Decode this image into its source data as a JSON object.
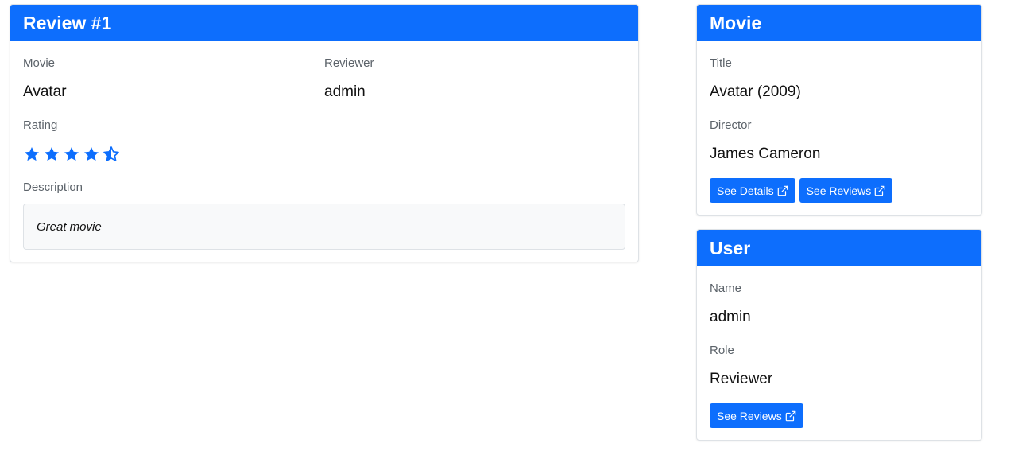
{
  "review": {
    "title": "Review #1",
    "movie_label": "Movie",
    "movie_value": "Avatar",
    "reviewer_label": "Reviewer",
    "reviewer_value": "admin",
    "rating_label": "Rating",
    "rating_value": 4.5,
    "rating_max": 5,
    "description_label": "Description",
    "description_value": "Great movie"
  },
  "movie": {
    "header": "Movie",
    "title_label": "Title",
    "title_value": "Avatar (2009)",
    "director_label": "Director",
    "director_value": "James Cameron",
    "see_details_label": "See Details",
    "see_reviews_label": "See Reviews"
  },
  "user": {
    "header": "User",
    "name_label": "Name",
    "name_value": "admin",
    "role_label": "Role",
    "role_value": "Reviewer",
    "see_reviews_label": "See Reviews"
  },
  "colors": {
    "primary": "#0d6efd",
    "star": "#0d6efd",
    "description_bg": "#f8f9fa"
  },
  "icons": {
    "star": "star-icon",
    "half_star": "half-star-icon",
    "external_link": "external-link-icon"
  }
}
